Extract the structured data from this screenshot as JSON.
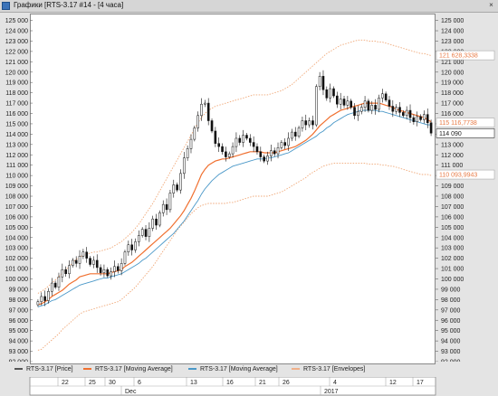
{
  "window": {
    "title": "Графики [RTS-3.17 #14 - [4 часа]",
    "close_glyph": "×"
  },
  "legend": [
    {
      "label": "RTS-3.17 [Price]",
      "color": "#555555"
    },
    {
      "label": "RTS-3.17 [Moving Average]",
      "color": "#f07030"
    },
    {
      "label": "RTS-3.17 [Moving Average]",
      "color": "#4a98c8"
    },
    {
      "label": "RTS-3.17 [Envelopes]",
      "color": "#f0b08a"
    }
  ],
  "chart_data": {
    "type": "candlestick",
    "ylim": [
      92000,
      125400
    ],
    "y_ticks": [
      "92 000",
      "93 000",
      "94 000",
      "95 000",
      "96 000",
      "97 000",
      "98 000",
      "99 000",
      "100 000",
      "101 000",
      "102 000",
      "103 000",
      "104 000",
      "105 000",
      "106 000",
      "107 000",
      "108 000",
      "109 000",
      "110 000",
      "111 000",
      "112 000",
      "113 000",
      "114 000",
      "115 000",
      "116 000",
      "117 000",
      "118 000",
      "119 000",
      "120 000",
      "121 000",
      "122 000",
      "123 000",
      "124 000",
      "125 000"
    ],
    "x_ticks_day": [
      "22",
      "25",
      "30",
      "6",
      "13",
      "16",
      "21",
      "26",
      "4",
      "12",
      "17"
    ],
    "x_ticks_month": [
      "Dec",
      "2017"
    ],
    "price_labels": [
      {
        "text": "121 628,3338",
        "value": 121628,
        "color": "#e87a45"
      },
      {
        "text": "115 116,7738",
        "value": 115117,
        "color": "#e87a45"
      },
      {
        "text": "114 090",
        "value": 114090,
        "color": "#222222"
      },
      {
        "text": "110 093,9943",
        "value": 110094,
        "color": "#e87a45"
      }
    ],
    "close": [
      97800,
      98300,
      97900,
      98800,
      99600,
      99200,
      100200,
      100900,
      100500,
      101300,
      101800,
      101500,
      102200,
      102600,
      102000,
      101400,
      101800,
      101100,
      100600,
      100900,
      100300,
      100700,
      101200,
      100800,
      101500,
      102600,
      103300,
      102800,
      103600,
      104200,
      104800,
      104100,
      104900,
      105800,
      105200,
      106400,
      107200,
      106700,
      108300,
      109100,
      108600,
      110200,
      111700,
      112600,
      113500,
      114600,
      115800,
      116900,
      117000,
      115300,
      114300,
      113100,
      112800,
      112300,
      111800,
      112100,
      112800,
      113600,
      113200,
      113900,
      113600,
      113200,
      112800,
      112300,
      111800,
      111400,
      111900,
      112400,
      112100,
      112700,
      113200,
      112900,
      113600,
      114200,
      113800,
      114600,
      115300,
      114900,
      115300,
      114900,
      118600,
      119600,
      118300,
      117500,
      118400,
      117700,
      116900,
      117400,
      116800,
      117200,
      116600,
      115800,
      116200,
      116600,
      117200,
      116300,
      116800,
      116400,
      117500,
      117900,
      117300,
      116700,
      116200,
      116600,
      116100,
      115800,
      116300,
      115600,
      115200,
      115700,
      115400,
      115900,
      115100,
      114100
    ],
    "ma_fast": [
      97500,
      97600,
      97800,
      98000,
      98300,
      98500,
      98700,
      98900,
      99200,
      99500,
      99700,
      99900,
      100200,
      100300,
      100400,
      100500,
      100500,
      100500,
      100500,
      100500,
      100500,
      100600,
      100700,
      100800,
      100900,
      101200,
      101400,
      101600,
      101900,
      102200,
      102500,
      102800,
      103100,
      103400,
      103700,
      104000,
      104300,
      104600,
      104900,
      105300,
      105700,
      106100,
      106600,
      107200,
      107800,
      108500,
      109300,
      110100,
      110600,
      111000,
      111200,
      111400,
      111500,
      111600,
      111600,
      111700,
      111800,
      111900,
      112000,
      112100,
      112200,
      112300,
      112300,
      112300,
      112300,
      112200,
      112200,
      112200,
      112200,
      112300,
      112400,
      112500,
      112600,
      112700,
      112800,
      113000,
      113200,
      113400,
      113700,
      114000,
      114400,
      114800,
      115100,
      115400,
      115700,
      115900,
      116100,
      116300,
      116400,
      116500,
      116600,
      116700,
      116800,
      116900,
      117000,
      117000,
      117000,
      117000,
      117000,
      116900,
      116800,
      116700,
      116600,
      116400,
      116300,
      116200,
      116100,
      116000,
      115900,
      115800,
      115700,
      115600,
      115400,
      115200
    ],
    "ma_slow": [
      97300,
      97400,
      97500,
      97700,
      97900,
      98000,
      98200,
      98400,
      98600,
      98800,
      99000,
      99200,
      99400,
      99500,
      99600,
      99700,
      99800,
      99900,
      100000,
      100100,
      100100,
      100200,
      100300,
      100400,
      100500,
      100700,
      100900,
      101100,
      101300,
      101500,
      101800,
      102000,
      102300,
      102600,
      102900,
      103200,
      103500,
      103800,
      104100,
      104400,
      104800,
      105200,
      105600,
      106100,
      106600,
      107100,
      107600,
      108200,
      108700,
      109100,
      109500,
      109800,
      110100,
      110300,
      110500,
      110700,
      110900,
      111000,
      111100,
      111200,
      111300,
      111400,
      111500,
      111600,
      111600,
      111600,
      111700,
      111700,
      111800,
      111900,
      112000,
      112100,
      112200,
      112400,
      112600,
      112800,
      113000,
      113200,
      113400,
      113600,
      113800,
      114100,
      114300,
      114600,
      114800,
      115100,
      115300,
      115500,
      115700,
      115900,
      116000,
      116100,
      116200,
      116300,
      116300,
      116300,
      116300,
      116300,
      116200,
      116200,
      116100,
      116000,
      115900,
      115800,
      115700,
      115600,
      115500,
      115400,
      115300,
      115200,
      115100,
      115000,
      114900,
      114900
    ],
    "env_upper": [
      98600,
      98800,
      99000,
      99300,
      99600,
      99900,
      100200,
      100600,
      100900,
      101200,
      101600,
      101900,
      102100,
      102300,
      102400,
      102500,
      102600,
      102600,
      102700,
      102800,
      102900,
      103000,
      103200,
      103400,
      103600,
      103900,
      104200,
      104500,
      104900,
      105300,
      105800,
      106300,
      106800,
      107300,
      107900,
      108500,
      109100,
      109700,
      110300,
      110900,
      111500,
      112100,
      112700,
      113300,
      113900,
      114500,
      115100,
      115600,
      116000,
      116300,
      116500,
      116700,
      116800,
      116900,
      117000,
      117100,
      117200,
      117300,
      117400,
      117500,
      117600,
      117700,
      117800,
      117800,
      117800,
      117800,
      117800,
      117900,
      118000,
      118100,
      118200,
      118400,
      118600,
      118800,
      119100,
      119400,
      119700,
      120000,
      120300,
      120600,
      120900,
      121200,
      121500,
      121800,
      122000,
      122200,
      122400,
      122600,
      122700,
      122800,
      122900,
      123000,
      123100,
      123100,
      123100,
      123000,
      123000,
      123000,
      122900,
      122900,
      122800,
      122700,
      122600,
      122500,
      122400,
      122300,
      122200,
      122100,
      122000,
      121900,
      121800,
      121800,
      121700,
      121600
    ],
    "env_lower": [
      93100,
      93200,
      93500,
      93800,
      94100,
      94400,
      94700,
      95100,
      95400,
      95700,
      96000,
      96300,
      96600,
      96800,
      96900,
      97000,
      97100,
      97200,
      97300,
      97400,
      97500,
      97600,
      97700,
      97800,
      98000,
      98300,
      98600,
      98900,
      99200,
      99600,
      100000,
      100400,
      100800,
      101200,
      101700,
      102200,
      102700,
      103200,
      103700,
      104200,
      104700,
      105100,
      105500,
      105900,
      106300,
      106600,
      106900,
      107100,
      107200,
      107300,
      107300,
      107300,
      107300,
      107300,
      107300,
      107400,
      107400,
      107500,
      107600,
      107700,
      107800,
      107900,
      108000,
      108000,
      108000,
      108000,
      108000,
      108100,
      108200,
      108300,
      108400,
      108600,
      108800,
      109000,
      109200,
      109400,
      109600,
      109800,
      110100,
      110300,
      110500,
      110700,
      110900,
      111000,
      111100,
      111200,
      111200,
      111200,
      111200,
      111200,
      111200,
      111200,
      111200,
      111200,
      111200,
      111100,
      111100,
      111100,
      111100,
      111000,
      111000,
      110900,
      110900,
      110800,
      110700,
      110600,
      110500,
      110400,
      110300,
      110200,
      110100,
      110100,
      110100,
      110000
    ]
  }
}
